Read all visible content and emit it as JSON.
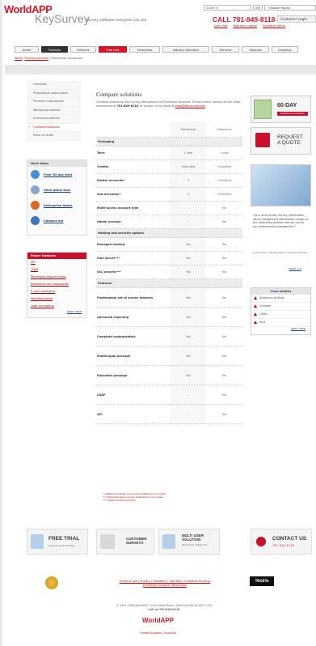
{
  "brand": {
    "line1": "WorldAPP",
    "line2": "KeySurvey",
    "tagline": "Survey software everyone can use"
  },
  "header": {
    "search_placeholder": "SEARCH",
    "search_button": ">>",
    "region_label": "Choose region",
    "phone": "CALL 781-849-8118",
    "customer_login": "Customer Login",
    "links": [
      "Live chat",
      "Request a quote",
      "Schedule demo"
    ]
  },
  "nav": {
    "tabs": [
      "Home",
      "Products",
      "Features",
      "Free trial",
      "Enterprise",
      "Industry Solutions",
      "Services",
      "Samples",
      "Company"
    ]
  },
  "breadcrumb": {
    "items": [
      "Home",
      "Products overview",
      "Subscription comparison"
    ]
  },
  "left_menu": {
    "items": [
      "Overview",
      "Professional subscription",
      "Premium subscription",
      "Workgroup solution",
      "Enterprise solution",
      "Compare solutions",
      "Place an order"
    ]
  },
  "next_steps": {
    "title": "Next steps",
    "items": [
      "Free 30 day trial",
      "View quick tour",
      "Enterprise demo",
      "Contact me"
    ]
  },
  "power_features": {
    "title": "Power features",
    "items": [
      "API",
      "LDAP",
      "Permission-based access",
      "Salesforce.com integration",
      "E-mail reminders",
      "Workflow alerts",
      "Logic and piping"
    ],
    "learn_more": "learn more"
  },
  "main": {
    "title": "Compare solutions",
    "intro": "Compare options for Key Survey Workgroup and Enterprise solutions. To learn more, please call our sales department at",
    "phone": "781-849-8118",
    "intro_tail": ", or contact us by email at",
    "email": "sales@keysurvey.com",
    "columns": [
      "Workgroup",
      "Enterprise"
    ],
    "sections": [
      {
        "name": "Packaging",
        "rows": [
          [
            "Term",
            "1 year",
            "1 year"
          ],
          [
            "Credits",
            "Unlimited",
            "Unlimited"
          ],
          [
            "Master accounts*",
            "1",
            "Unlimited"
          ],
          [
            "Sub accounts**",
            "5",
            "Unlimited"
          ],
          [
            "Multi-access account type",
            "–",
            "Yes"
          ],
          [
            "Admin account",
            "–",
            "Yes"
          ]
        ]
      },
      {
        "name": "Hosting and security options",
        "rows": [
          [
            "Managed hosting",
            "Yes",
            "Yes"
          ],
          [
            "Own server***",
            "Yes",
            "Yes"
          ],
          [
            "SSL security***",
            "Yes",
            "Yes"
          ]
        ]
      },
      {
        "name": "Features",
        "rows": [
          [
            "Professional set of survey features",
            "Yes",
            "Yes"
          ],
          [
            "Advanced reporting",
            "Yes",
            "Yes"
          ],
          [
            "Complete customization",
            "Yes",
            "Yes"
          ],
          [
            "Multilingual package",
            "Yes",
            "Yes"
          ],
          [
            "Education package",
            "Yes",
            "Yes"
          ],
          [
            "LDAP",
            "–",
            "Yes"
          ],
          [
            "API",
            "–",
            "Yes"
          ]
        ]
      }
    ],
    "footnotes": [
      "* Additional master accounts available for purchase",
      "** Additional sub-accounts available for purchase",
      "*** Additional fee required."
    ]
  },
  "right": {
    "trial_big": "60-DAY",
    "trial_small": "Enterprise evaluation",
    "request": "REQUEST A QUOTE",
    "quote": "\"As a result of Key Survey information, we've changed the distribution ranges on the calibration process that we use for our performance management.\"",
    "quote_author": "Janice Chan, HR specialist, American Airlines",
    "more": "more >>",
    "case_title": "Case studies",
    "cases": [
      "American Airlines",
      "Unilever",
      "OMAC",
      "NLG"
    ],
    "learn_more": "learn more"
  },
  "promos": [
    {
      "title": "FREE TRIAL",
      "sub": "Key Survey for 30 Days"
    },
    {
      "title": "CUSTOMER SURVEYS",
      "sub": ""
    },
    {
      "title": "MULTI USER SOLUTION",
      "sub": "Workgroup, Enterprise"
    },
    {
      "title": "CONTACT US",
      "sub": "781-849-8118"
    }
  ],
  "footer": {
    "links1": "Terms of use | Privacy | Feedback | Site Map | Customer Surveys",
    "links2": "Employee Surveys | Resources",
    "copyright": "© 2001-2008 WorldAPP • 222 Forbes Road • Braintree MA 02184 • USA",
    "call": "Call us 781-849-8118",
    "logo": "WorldAPP",
    "countries": "United Kingdom | Australia",
    "truste": "TRUSTe"
  },
  "colors": {
    "brand_red": "#d9152a",
    "link_blue": "#1e3f7a"
  }
}
